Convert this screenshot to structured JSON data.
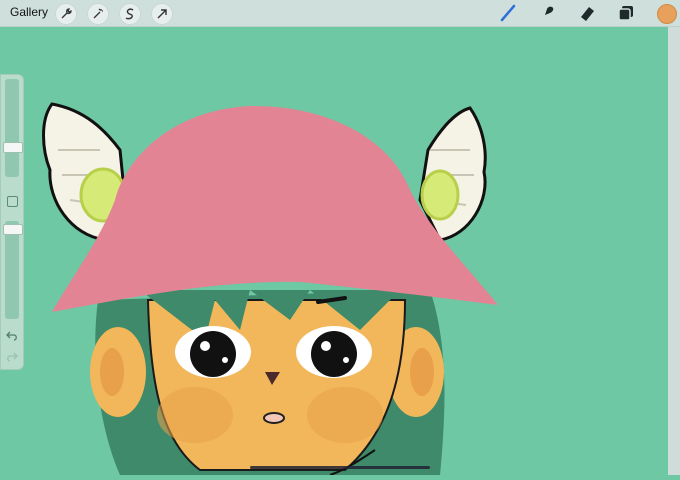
{
  "topbar": {
    "gallery_label": "Gallery",
    "left_tools": [
      {
        "icon": "wrench-icon"
      },
      {
        "icon": "magic-wand-icon"
      },
      {
        "icon": "selection-icon"
      },
      {
        "icon": "transform-arrow-icon"
      }
    ],
    "right_tools": [
      {
        "icon": "brush-icon",
        "active": true
      },
      {
        "icon": "smudge-icon"
      },
      {
        "icon": "eraser-icon"
      },
      {
        "icon": "layers-icon"
      }
    ],
    "current_color": "#e8a15c",
    "active_tool_color": "#2f6fd8"
  },
  "sidebar": {
    "brush_size_level": 0.72,
    "opacity_level": 0.98,
    "icons": [
      "modify-square-icon",
      "undo-icon",
      "redo-icon"
    ]
  },
  "canvas": {
    "background": "#6ec8a4",
    "hat_color": "#e28494",
    "hair_color": "#3e8a6a",
    "skin_color": "#f2b75a",
    "wing_color": "#f5f2e6"
  }
}
